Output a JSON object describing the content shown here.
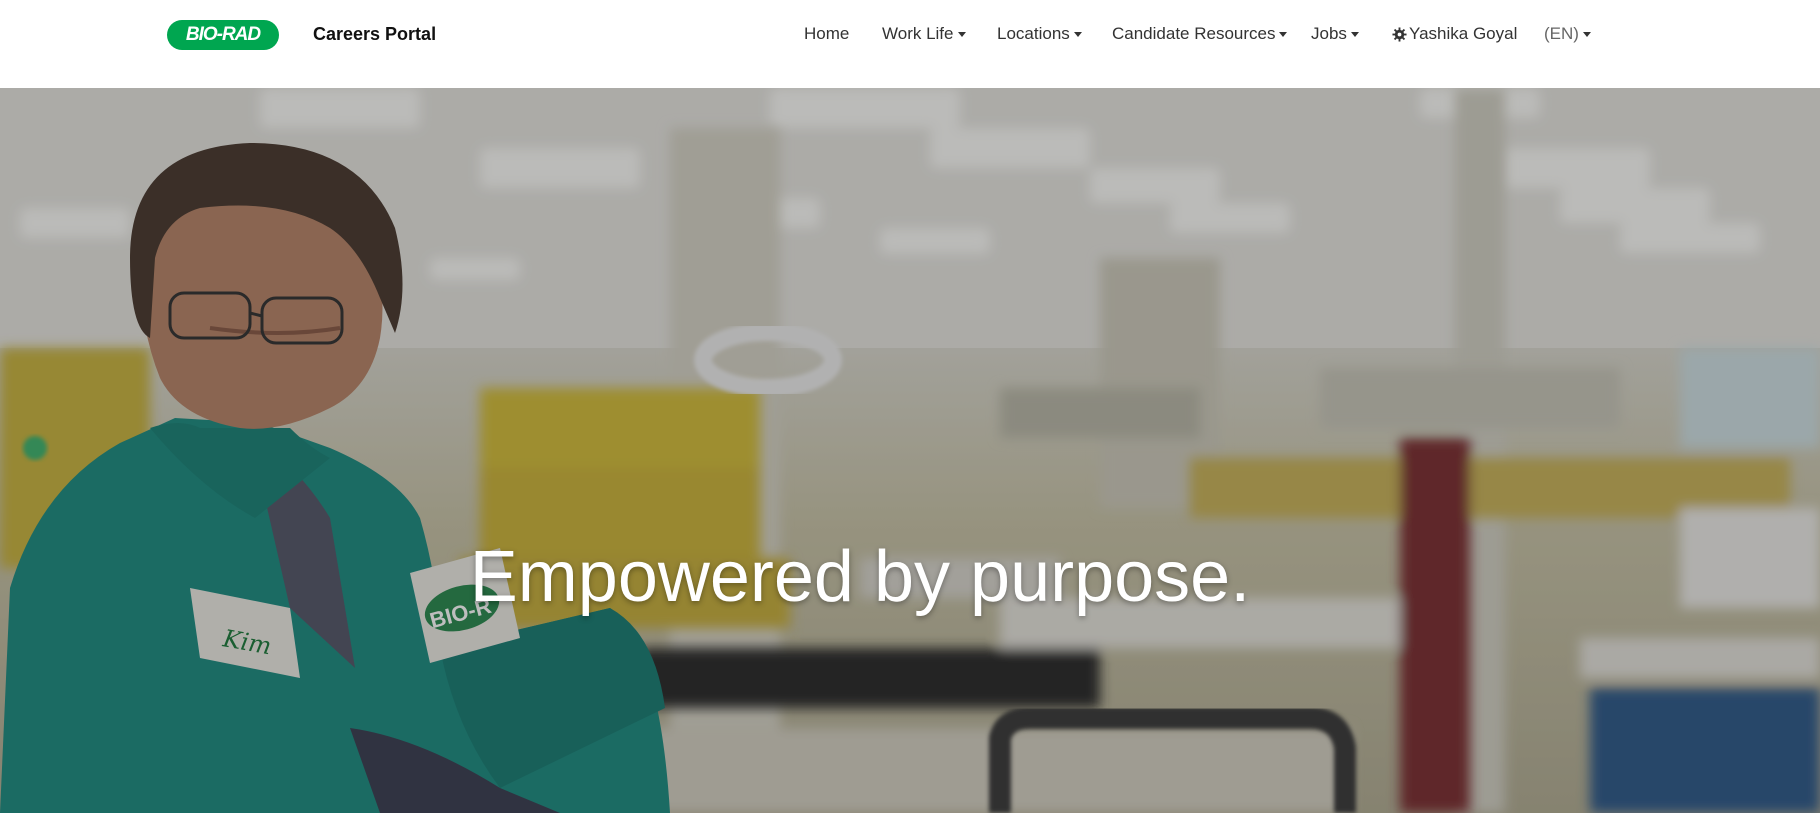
{
  "brand": {
    "logo_text": "BIO-RAD",
    "title": "Careers Portal",
    "accent_color": "#00a650"
  },
  "nav": {
    "home": "Home",
    "work_life": "Work Life",
    "locations": "Locations",
    "candidate_resources": "Candidate Resources",
    "jobs": "Jobs",
    "user": "Yashika Goyal",
    "language": "(EN)",
    "user_icon": "gear-icon",
    "dropdown_icon": "caret-down-icon"
  },
  "hero": {
    "headline": "Empowered by purpose.",
    "badge_name": "Kim",
    "badge_logo": "BIO-R"
  }
}
